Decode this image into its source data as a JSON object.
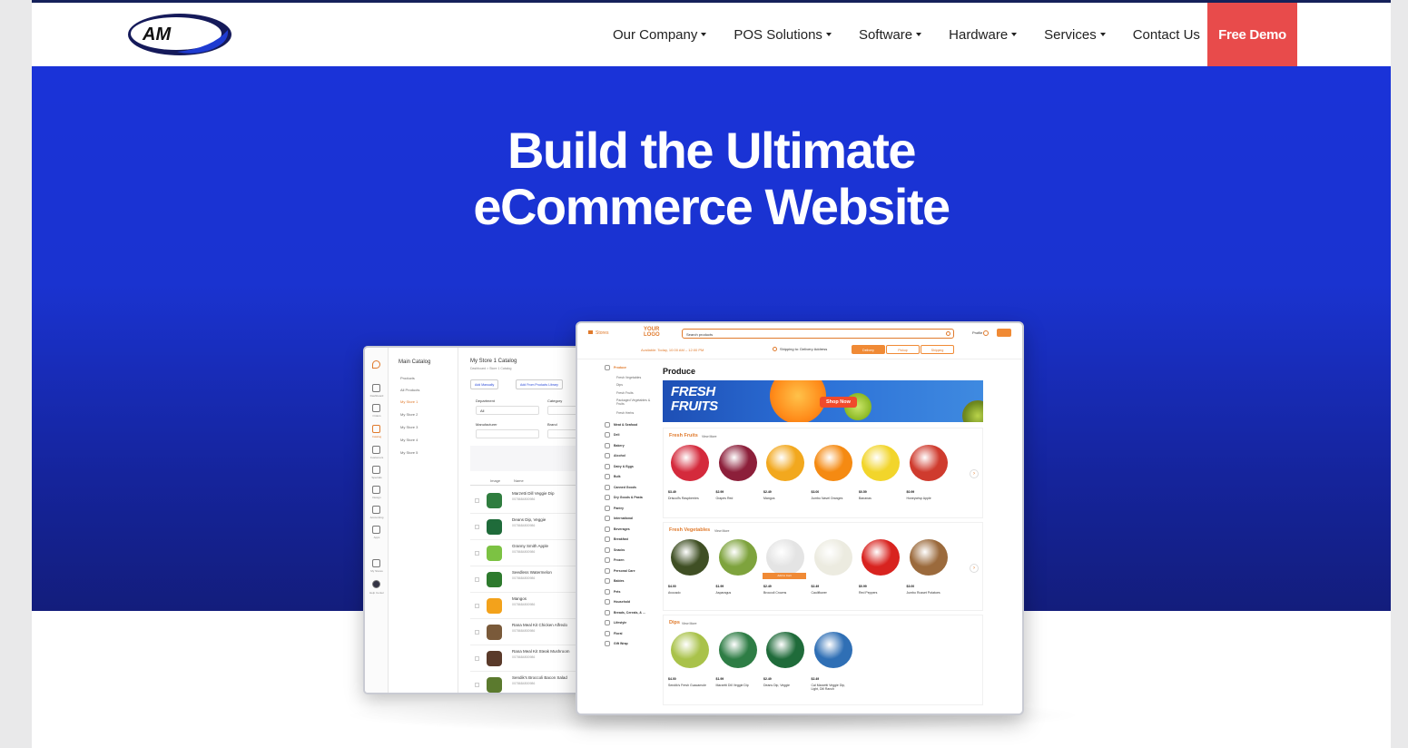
{
  "nav": {
    "logo_text": "AM PM",
    "items": [
      {
        "label": "Our Company"
      },
      {
        "label": "POS Solutions"
      },
      {
        "label": "Software"
      },
      {
        "label": "Hardware"
      },
      {
        "label": "Services"
      },
      {
        "label": "Contact Us"
      }
    ],
    "cta_label": "Free Demo"
  },
  "hero": {
    "title_line1": "Build the Ultimate",
    "title_line2": "eCommerce Website"
  },
  "admin": {
    "catalog_title": "Main Catalog",
    "catalog_items": [
      "Products",
      "All Products",
      "My Store 1",
      "My Store 2",
      "My Store 3",
      "My Store 4",
      "My Store 5"
    ],
    "main_title": "My Store 1 Catalog",
    "breadcrumb": "Dashboard > Store 1 Catalog",
    "add_manually": "Add Manually",
    "add_library": "Add From Products Library",
    "department_label": "Department",
    "department_value": "All",
    "category_label": "Category",
    "manufacturer_label": "Manufacturer",
    "brand_label": "Brand",
    "col_image": "Image",
    "col_name": "Name",
    "rows": [
      {
        "name": "Marzetti Dill Veggie Dip",
        "code": "0078684800986"
      },
      {
        "name": "Deans Dip, Veggie",
        "code": "0078684800986"
      },
      {
        "name": "Granny Smith Apple",
        "code": "0078684800986"
      },
      {
        "name": "Seedless Watermelon",
        "code": "0078684800986"
      },
      {
        "name": "Mangos",
        "code": "0078684800986"
      },
      {
        "name": "Rana Meal Kit Chicken Alfredo",
        "code": "0078684800986"
      },
      {
        "name": "Rana Meal Kit Steak Mushroom",
        "code": "0078684800986"
      },
      {
        "name": "Sendik's Broccoli Bacon Salad",
        "code": "0078684800986"
      }
    ],
    "rail_labels": [
      "Dashboard",
      "Orders",
      "Catalog",
      "Customers",
      "Specials",
      "Design",
      "Accounting",
      "Apps",
      "My Stores",
      "Help Center"
    ]
  },
  "store": {
    "stores_label": "Stores",
    "logo_line1": "YOUR",
    "logo_line2": "LOGO",
    "search_placeholder": "Search products",
    "profile_label": "Profile",
    "availability": "Available: Today, 10:00 AM – 12:00 PM",
    "shipping": "Shipping to: Delivery Address",
    "tabs": [
      "Delivery",
      "Pickup",
      "Shipping"
    ],
    "section_title": "Produce",
    "banner_line1": "FRESH",
    "banner_line2": "FRUITS",
    "banner_cta": "Shop Now",
    "categories": [
      "Produce",
      "Meat & Seafood",
      "Deli",
      "Bakery",
      "Alcohol",
      "Dairy & Eggs",
      "Bulk",
      "Canned Goods",
      "Dry Goods & Pasta",
      "Pantry",
      "International",
      "Beverages",
      "Breakfast",
      "Snacks",
      "Frozen",
      "Personal Care",
      "Babies",
      "Pets",
      "Household",
      "Breads, Cereals, & ...",
      "Lifestyle",
      "Floral",
      "Gift Wrap"
    ],
    "subcategories": [
      "Fresh Vegetables",
      "Dips",
      "Fresh Fruits",
      "Packaged Vegetables & Fruits",
      "Fresh Herbs"
    ],
    "view_more": "View More",
    "fruits_title": "Fresh Fruits",
    "fruits": [
      {
        "price": "$3.49",
        "name": "Driscoll's Raspberries",
        "color": "#d42a3c"
      },
      {
        "price": "$2.99",
        "name": "Grapes Red",
        "color": "#8c1f3a"
      },
      {
        "price": "$2.49",
        "name": "Mangos",
        "color": "#f2a81e"
      },
      {
        "price": "$3.00",
        "name": "Jumbo Navel Oranges",
        "color": "#f58a12"
      },
      {
        "price": "$0.59",
        "name": "Bananas",
        "color": "#f2d52b"
      },
      {
        "price": "$0.99",
        "name": "Honeycrisp Apple",
        "color": "#cf3b2e"
      }
    ],
    "veg_title": "Fresh Vegetables",
    "vegetables": [
      {
        "price": "$4.00",
        "name": "Avocado",
        "color": "#3f4f24"
      },
      {
        "price": "$1.99",
        "name": "Asparagus",
        "color": "#7ea33d"
      },
      {
        "price": "$2.49",
        "name": "Broccoli Crowns",
        "color": "#e4e4e4"
      },
      {
        "price": "$2.49",
        "name": "Cauliflower",
        "color": "#ecebe0"
      },
      {
        "price": "$0.99",
        "name": "Red Peppers",
        "color": "#d8231f"
      },
      {
        "price": "$3.00",
        "name": "Jumbo Russet Potatoes",
        "color": "#9b6a3c"
      }
    ],
    "add_to_cart": "Add to Cart",
    "dips_title": "Dips",
    "dips": [
      {
        "price": "$4.00",
        "name": "Sendik's Fresh Guacamole",
        "color": "#a9c24a"
      },
      {
        "price": "$1.99",
        "name": "Marzetti Dill Veggie Dip",
        "color": "#2e7d45"
      },
      {
        "price": "$2.49",
        "name": "Deans Dip, Veggie",
        "color": "#1f6b3a"
      },
      {
        "price": "$2.49",
        "name": "Cal Marzetti Veggie Dip, Light, Dill Ranch",
        "color": "#2f6fb5"
      }
    ]
  },
  "colors": {
    "hero_blue": "#1a33d8",
    "cta_red": "#e84b4b",
    "accent_orange": "#f08a35",
    "nav_border": "#15215a"
  }
}
